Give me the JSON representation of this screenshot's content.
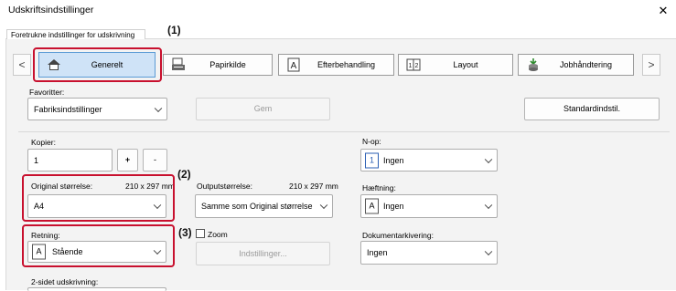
{
  "window": {
    "title": "Udskriftsindstillinger",
    "close_glyph": "✕"
  },
  "tab": {
    "label": "Foretrukne indstillinger for udskrivning"
  },
  "toolbar": {
    "prev_glyph": "<",
    "next_glyph": ">",
    "buttons": [
      {
        "label": "Generelt",
        "icon": "home-icon"
      },
      {
        "label": "Papirkilde",
        "icon": "paper-tray-icon"
      },
      {
        "label": "Efterbehandling",
        "icon": "finishing-icon"
      },
      {
        "label": "Layout",
        "icon": "layout-icon"
      },
      {
        "label": "Jobhåndtering",
        "icon": "job-handling-icon"
      }
    ]
  },
  "markers": {
    "m1": "(1)",
    "m2": "(2)",
    "m3": "(3)"
  },
  "favorites": {
    "label": "Favoritter:",
    "value": "Fabriksindstillinger",
    "save": "Gem",
    "default": "Standardindstil."
  },
  "copies": {
    "label": "Kopier:",
    "value": "1",
    "plus": "+",
    "minus": "-"
  },
  "original_size": {
    "label": "Original størrelse:",
    "dims": "210 x 297 mm",
    "value": "A4"
  },
  "output_size": {
    "label": "Outputstørrelse:",
    "dims": "210 x 297 mm",
    "value": "Samme som Original størrelse"
  },
  "orientation": {
    "label": "Retning:",
    "value": "Stående",
    "icon_letter": "A"
  },
  "zoom": {
    "label": "Zoom",
    "settings": "Indstillinger..."
  },
  "duplex": {
    "label": "2-sidet udskrivning:"
  },
  "nup": {
    "label": "N-op:",
    "value": "Ingen",
    "icon_digit": "1"
  },
  "stapling": {
    "label": "Hæftning:",
    "value": "Ingen",
    "icon_letter": "A"
  },
  "doc_archiving": {
    "label": "Dokumentarkivering:",
    "value": "Ingen"
  },
  "colors": {
    "accent_red": "#c8102e",
    "panel_bg": "#f3f3f3"
  }
}
